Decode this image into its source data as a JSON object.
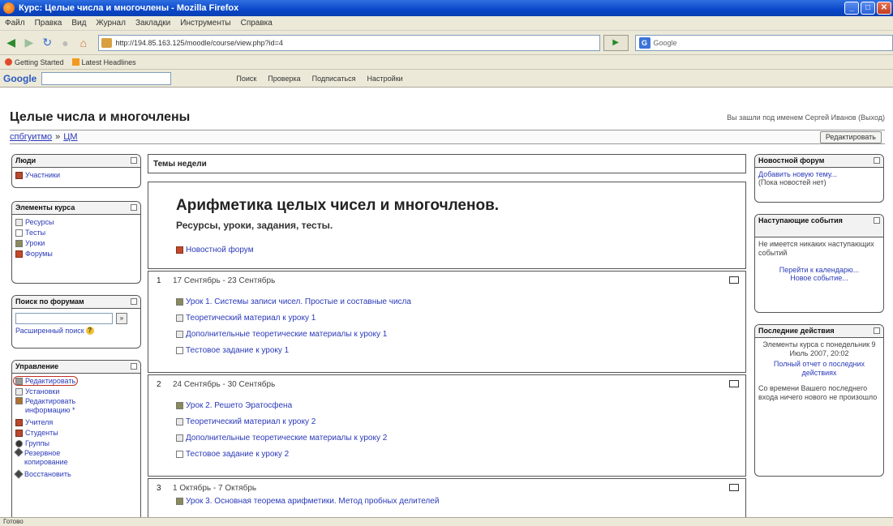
{
  "window": {
    "title": "Курс: Целые числа и многочлены - Mozilla Firefox"
  },
  "menu": [
    "Файл",
    "Правка",
    "Вид",
    "Журнал",
    "Закладки",
    "Инструменты",
    "Справка"
  ],
  "nav": {
    "url": "http://194.85.163.125/moodle/course/view.php?id=4",
    "search_placeholder": "Google"
  },
  "bookmarks": [
    "Getting Started",
    "Latest Headlines"
  ],
  "gtoolbar": {
    "logo": "Google",
    "items": [
      "Поиск",
      "Проверка",
      "Подписаться",
      "Настройки"
    ]
  },
  "header": {
    "course_title": "Целые числа и многочлены",
    "login_info": "Вы зашли под именем Сергей Иванов (Выход)",
    "breadcrumb": [
      "спбгуитмо",
      "ЦМ"
    ],
    "edit_button": "Редактировать"
  },
  "left": {
    "people": {
      "title": "Люди",
      "items": [
        "Участники"
      ]
    },
    "elements": {
      "title": "Элементы курса",
      "items": [
        "Ресурсы",
        "Тесты",
        "Уроки",
        "Форумы"
      ]
    },
    "forum_search": {
      "title": "Поиск по форумам",
      "go": "»",
      "advanced": "Расширенный поиск"
    },
    "admin": {
      "title": "Управление",
      "items": [
        "Редактировать",
        "Установки",
        "Редактировать информацию *",
        "Учителя",
        "Студенты",
        "Группы",
        "Резервное копирование",
        "Восстановить"
      ]
    }
  },
  "center": {
    "header": "Темы недели",
    "section0": {
      "title": "Арифметика целых чисел и многочленов.",
      "subtitle": "Ресурсы, уроки, задания, тесты.",
      "forum": "Новостной форум"
    },
    "sections": [
      {
        "num": "1",
        "title": "17 Сентябрь - 23 Сентябрь",
        "items": [
          "Урок 1. Системы записи чисел. Простые и составные числа",
          "Теоретический материал к уроку 1",
          "Дополнительные теоретические материалы к уроку 1",
          "Тестовое задание к уроку 1"
        ]
      },
      {
        "num": "2",
        "title": "24 Сентябрь - 30 Сентябрь",
        "items": [
          "Урок 2. Решето Эратосфена",
          "Теоретический материал к уроку 2",
          "Дополнительные теоретические материалы к уроку 2",
          "Тестовое задание к уроку 2"
        ]
      },
      {
        "num": "3",
        "title": "1 Октябрь - 7 Октябрь",
        "items": [
          "Урок 3. Основная теорема арифметики. Метод пробных делителей"
        ]
      }
    ]
  },
  "right": {
    "news": {
      "title": "Новостной форум",
      "add": "Добавить новую тему...",
      "none": "(Пока новостей нет)"
    },
    "upcoming": {
      "title": "Наступающие события",
      "none": "Не имеется никаких наступающих событий",
      "calendar": "Перейти к календарю...",
      "new_event": "Новое событие..."
    },
    "recent": {
      "title": "Последние действия",
      "since": "Элементы курса с понедельник 9 Июль 2007, 20:02",
      "full": "Полный отчет о последних действиях",
      "nothing": "Со времени Вашего последнего входа ничего нового не произошло"
    }
  },
  "status": "Готово"
}
